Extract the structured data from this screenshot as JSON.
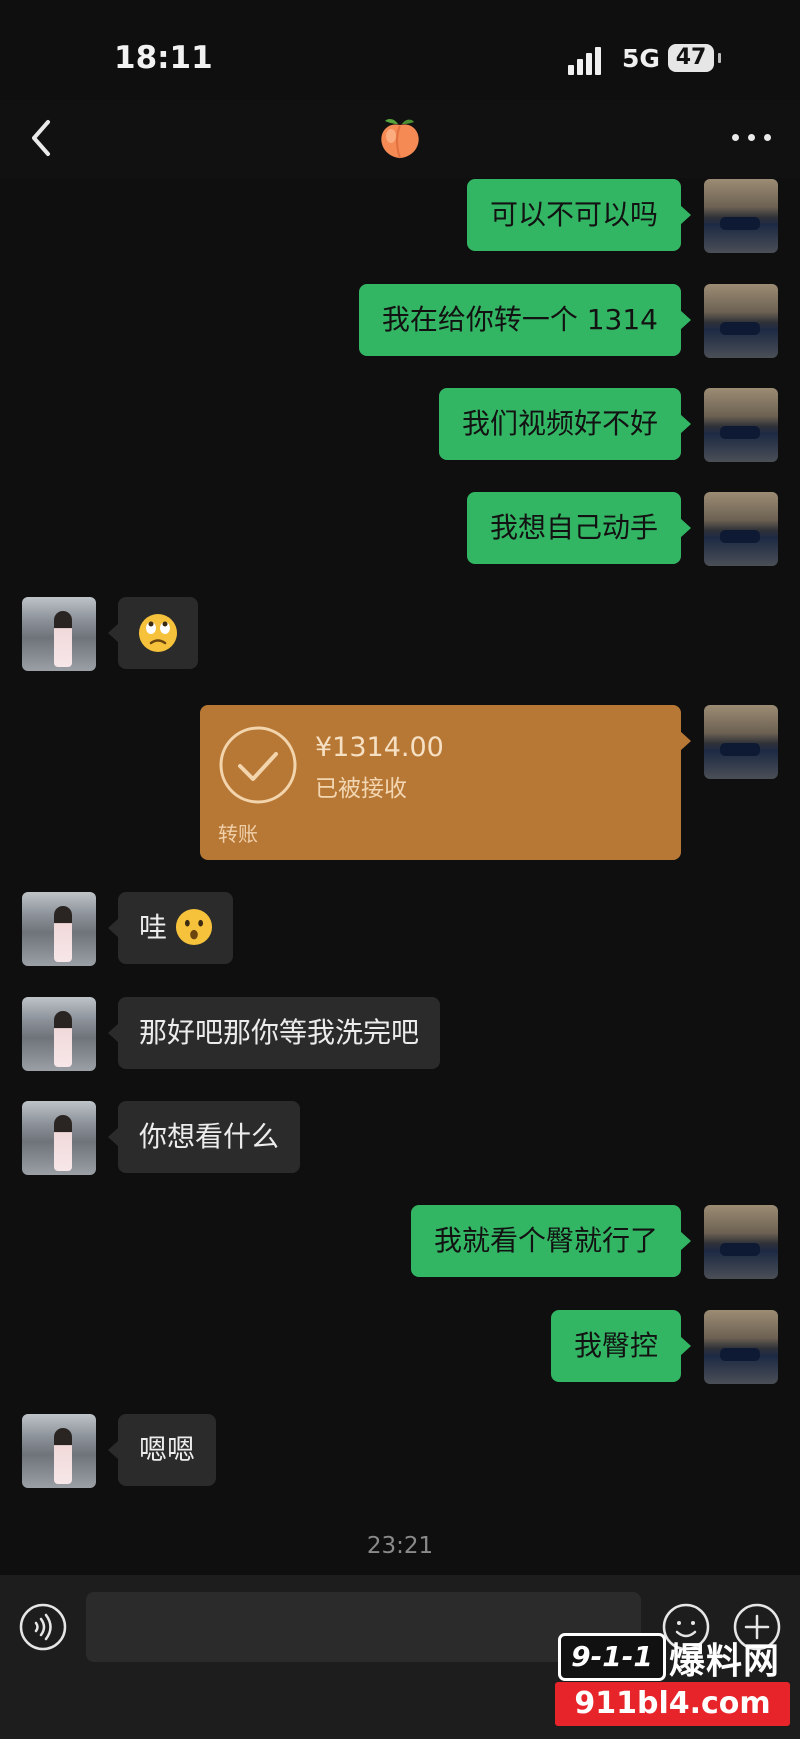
{
  "status_bar": {
    "time": "18:11",
    "network": "5G",
    "battery": "47"
  },
  "header": {
    "title_icon": "peach-emoji-icon"
  },
  "messages": [
    {
      "from": "me",
      "text": "可以不可以吗"
    },
    {
      "from": "me",
      "text": "我在给你转一个 1314"
    },
    {
      "from": "me",
      "text": "我们视频好不好"
    },
    {
      "from": "me",
      "text": "我想自己动手"
    },
    {
      "from": "her",
      "text": "",
      "emoji": "rolling-eyes-emoji-icon"
    },
    {
      "from": "me",
      "type": "transfer",
      "amount": "¥1314.00",
      "status": "已被接收",
      "label": "转账"
    },
    {
      "from": "her",
      "text": "哇",
      "emoji": "hushed-face-emoji-icon"
    },
    {
      "from": "her",
      "text": "那好吧那你等我洗完吧"
    },
    {
      "from": "her",
      "text": "你想看什么"
    },
    {
      "from": "me",
      "text": "我就看个臀就行了"
    },
    {
      "from": "me",
      "text": "我臀控"
    },
    {
      "from": "her",
      "text": "嗯嗯"
    }
  ],
  "timestamp": "23:21",
  "input": {
    "placeholder": "",
    "value": ""
  },
  "watermark": {
    "badge": "9-1-1",
    "name": "爆料网",
    "url": "911bl4.com"
  },
  "colors": {
    "my_bubble": "#33b664",
    "her_bubble": "#2b2b2b",
    "transfer_card": "#b87835",
    "background": "#0f0f0f"
  }
}
